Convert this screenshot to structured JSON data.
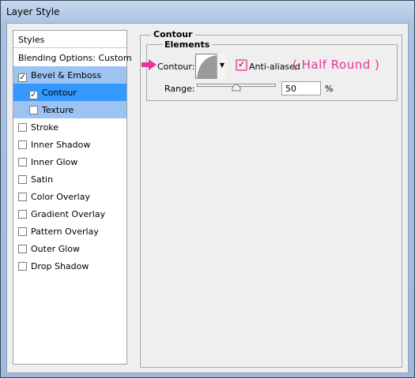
{
  "window": {
    "title": "Layer Style"
  },
  "styles_panel": {
    "header": "Styles",
    "blending_options": "Blending Options: Custom",
    "items": [
      {
        "label": "Bevel & Emboss",
        "checked": true,
        "state": "selected-parent"
      },
      {
        "label": "Contour",
        "checked": true,
        "state": "selected",
        "indent": true
      },
      {
        "label": "Texture",
        "checked": false,
        "state": "selected-parent",
        "indent": true
      },
      {
        "label": "Stroke",
        "checked": false
      },
      {
        "label": "Inner Shadow",
        "checked": false
      },
      {
        "label": "Inner Glow",
        "checked": false
      },
      {
        "label": "Satin",
        "checked": false
      },
      {
        "label": "Color Overlay",
        "checked": false
      },
      {
        "label": "Gradient Overlay",
        "checked": false
      },
      {
        "label": "Pattern Overlay",
        "checked": false
      },
      {
        "label": "Outer Glow",
        "checked": false
      },
      {
        "label": "Drop Shadow",
        "checked": false
      }
    ],
    "check_mark": "✓"
  },
  "contour_panel": {
    "group_title": "Contour",
    "elements_title": "Elements",
    "contour_label": "Contour:",
    "contour_shape_icon": "half-round-curve-icon",
    "anti_aliased_label": "Anti-aliased",
    "anti_aliased_checked": true,
    "annotation": "( Half Round )",
    "range_label": "Range:",
    "range_value": "50",
    "range_percent_value": 50,
    "percent_sign": "%"
  },
  "colors": {
    "selection_dark": "#3399ff",
    "selection_light": "#9cc3f2",
    "annotation_pink": "#e8339a"
  }
}
